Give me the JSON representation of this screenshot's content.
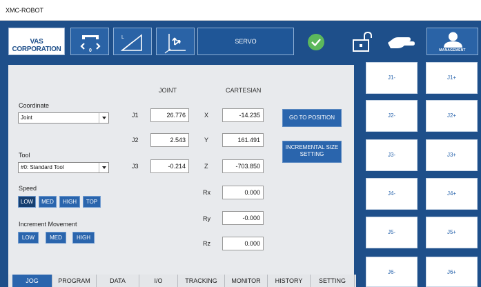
{
  "window": {
    "title": "XMC-ROBOT"
  },
  "topbar": {
    "logo_text": "VAS CORPORATION",
    "buttons": [
      {
        "icon": "gripper-icon"
      },
      {
        "icon": "linear-move-icon"
      },
      {
        "icon": "coordinate-frame-icon"
      }
    ],
    "servo_label": "SERVO",
    "status_icon": "check-circle-icon",
    "status_color": "#5cb85c",
    "unlock_icon": "unlock-icon",
    "hand_icon": "hand-icon",
    "management_label": "MANAGEMENT"
  },
  "main": {
    "col_joint": "JOINT",
    "col_cartesian": "CARTESIAN",
    "coordinate_label": "Coordinate",
    "coordinate_value": "Joint",
    "tool_label": "Tool",
    "tool_value": "#0: Standard Tool",
    "speed_label": "Speed",
    "speed_options": [
      "LOW",
      "MED",
      "HIGH",
      "TOP"
    ],
    "speed_selected": "LOW",
    "increment_label": "Increment Movement",
    "increment_options": [
      "LOW",
      "MED",
      "HIGH"
    ],
    "joints": [
      {
        "label": "J1",
        "value": "26.776"
      },
      {
        "label": "J2",
        "value": "2.543"
      },
      {
        "label": "J3",
        "value": "-0.214"
      }
    ],
    "cartesian": [
      {
        "label": "X",
        "value": "-14.235"
      },
      {
        "label": "Y",
        "value": "161.491"
      },
      {
        "label": "Z",
        "value": "-703.850"
      },
      {
        "label": "Rx",
        "value": "0.000"
      },
      {
        "label": "Ry",
        "value": "-0.000"
      },
      {
        "label": "Rz",
        "value": "0.000"
      }
    ],
    "go_to_position": "GO TO POSITION",
    "incremental_line1": "INCREMENTAL SIZE",
    "incremental_line2": "SETTING"
  },
  "tabs": [
    "JOG",
    "PROGRAM",
    "DATA",
    "I/O",
    "TRACKING",
    "MONITOR",
    "HISTORY",
    "SETTING"
  ],
  "tab_selected": "JOG",
  "jog": {
    "minus": [
      "J1-",
      "J2-",
      "J3-",
      "J4-",
      "J5-",
      "J6-"
    ],
    "plus": [
      "J1+",
      "J2+",
      "J3+",
      "J4+",
      "J5+",
      "J6+"
    ]
  },
  "colors": {
    "brand_blue": "#1e4f8a",
    "button_blue": "#2a65ad",
    "panel_gray": "#e8eaed"
  }
}
